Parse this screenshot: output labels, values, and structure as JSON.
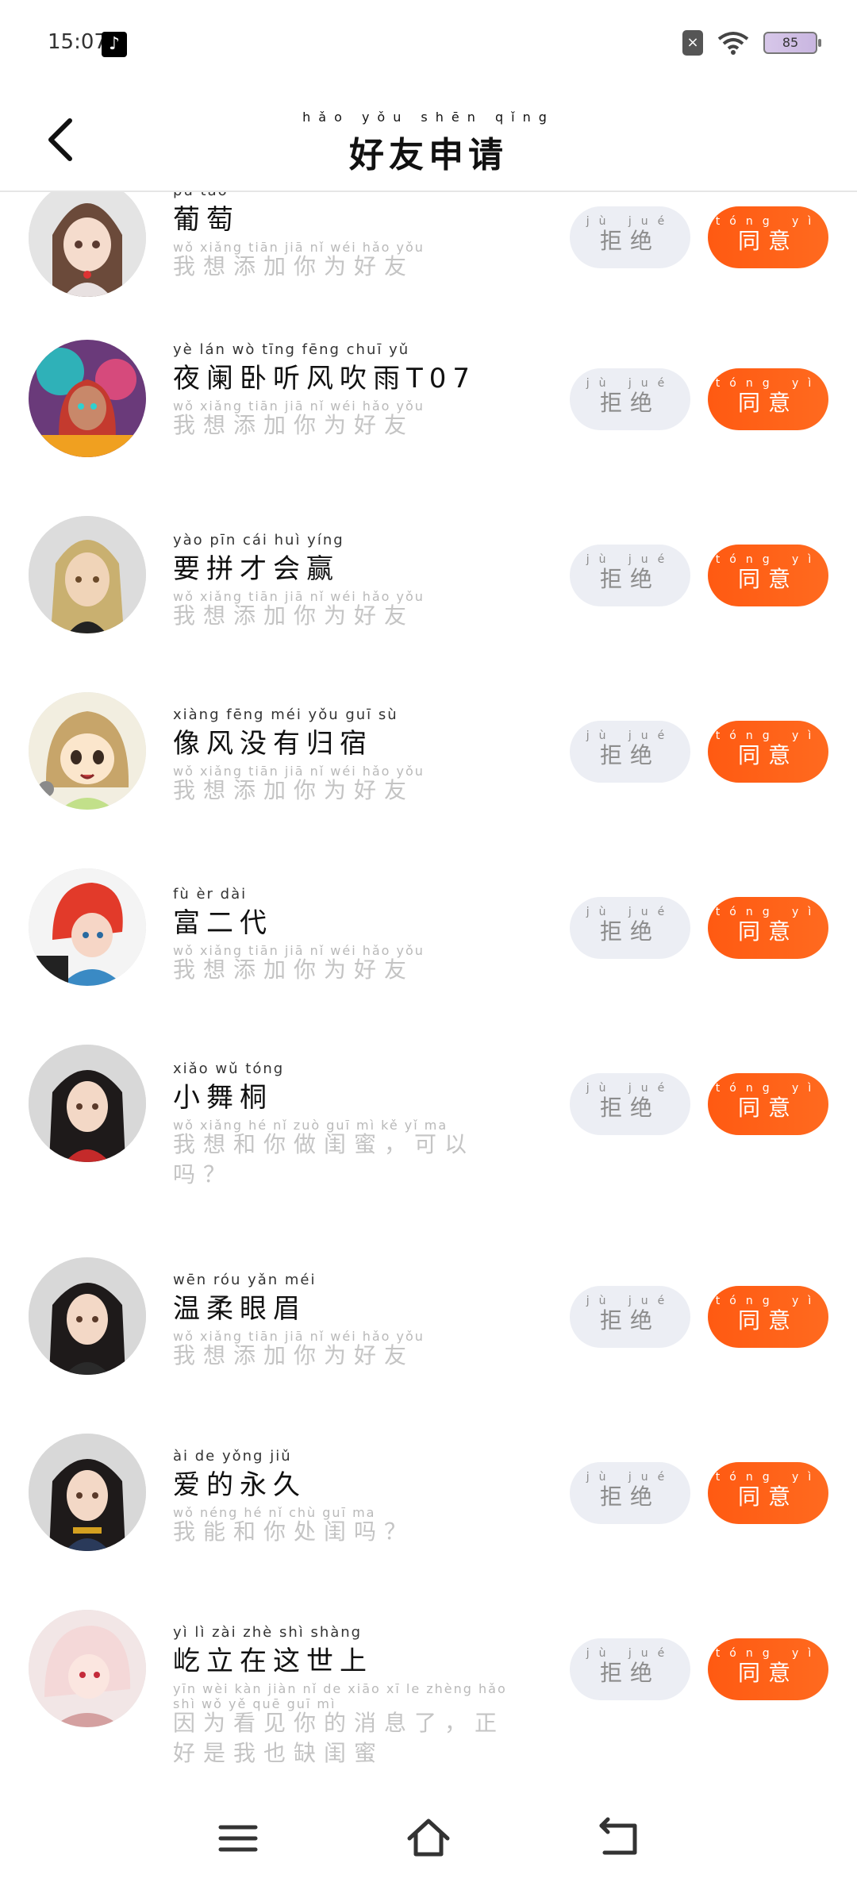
{
  "status": {
    "time": "15:07",
    "battery": "85"
  },
  "header": {
    "title": "好友申请",
    "title_pinyin": "hǎo yǒu shēn qǐng"
  },
  "buttons": {
    "reject_label": "拒绝",
    "reject_pinyin": "jù jué",
    "accept_label": "同意",
    "accept_pinyin": "tóng yì"
  },
  "requests": [
    {
      "name": "葡萄",
      "name_pinyin": "pú táo",
      "message": "我想添加你为好友",
      "message_pinyin": "wǒ xiǎng tiān jiā nǐ wéi hǎo yǒu"
    },
    {
      "name": "夜阑卧听风吹雨T07",
      "name_pinyin": "yè lán wò tīng fēng chuī yǔ",
      "message": "我想添加你为好友",
      "message_pinyin": "wǒ xiǎng tiān jiā nǐ wéi hǎo yǒu"
    },
    {
      "name": "要拼才会赢",
      "name_pinyin": "yào pīn cái huì yíng",
      "message": "我想添加你为好友",
      "message_pinyin": "wǒ xiǎng tiān jiā nǐ wéi hǎo yǒu"
    },
    {
      "name": "像风没有归宿",
      "name_pinyin": "xiàng fēng méi yǒu guī sù",
      "message": "我想添加你为好友",
      "message_pinyin": "wǒ xiǎng tiān jiā nǐ wéi hǎo yǒu"
    },
    {
      "name": "富二代",
      "name_pinyin": "fù èr dài",
      "message": "我想添加你为好友",
      "message_pinyin": "wǒ xiǎng tiān jiā nǐ wéi hǎo yǒu"
    },
    {
      "name": "小舞桐",
      "name_pinyin": "xiǎo wǔ tóng",
      "message": "我想和你做闺蜜，可以吗？",
      "message_pinyin": "wǒ xiǎng hé nǐ zuò guī mì kě yǐ ma"
    },
    {
      "name": "温柔眼眉",
      "name_pinyin": "wēn róu yǎn méi",
      "message": "我想添加你为好友",
      "message_pinyin": "wǒ xiǎng tiān jiā nǐ wéi hǎo yǒu"
    },
    {
      "name": "爱的永久",
      "name_pinyin": "ài de yǒng jiǔ",
      "message": "我能和你处闺吗？",
      "message_pinyin": "wǒ néng hé nǐ chù guī ma"
    },
    {
      "name": "屹立在这世上",
      "name_pinyin": "yì lì zài zhè shì shàng",
      "message": "因为看见你的消息了，正好是我也缺闺蜜",
      "message_pinyin": "yīn wèi kàn jiàn nǐ de xiāo xī le zhèng hǎo shì wǒ yě quē guī mì"
    }
  ],
  "colors": {
    "accent": "#ff5a12",
    "reject_bg": "#eceef4"
  }
}
